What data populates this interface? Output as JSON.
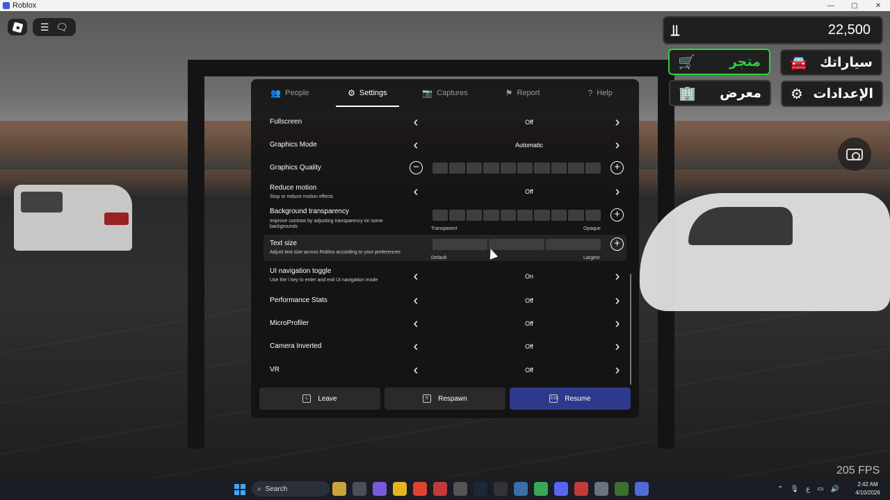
{
  "window": {
    "title": "Roblox",
    "controls": [
      "—",
      "▢",
      "✕"
    ]
  },
  "hud": {
    "currency_symbol": "⃁",
    "money": "22,500",
    "buttons": [
      {
        "id": "store",
        "label": "متجر",
        "icon": "cart-icon",
        "accent": "#2bd33a"
      },
      {
        "id": "my-cars",
        "label": "سياراتك",
        "icon": "car-icon"
      },
      {
        "id": "showroom",
        "label": "معرض",
        "icon": "showroom-icon"
      },
      {
        "id": "settings",
        "label": "الإعدادات",
        "icon": "gear-icon"
      }
    ],
    "fps": "205 FPS"
  },
  "tabs": [
    {
      "label": "People",
      "icon": "people-icon",
      "active": false
    },
    {
      "label": "Settings",
      "icon": "gear-icon",
      "active": true
    },
    {
      "label": "Captures",
      "icon": "camera-icon",
      "active": false
    },
    {
      "label": "Report",
      "icon": "flag-icon",
      "active": false
    },
    {
      "label": "Help",
      "icon": "help-icon",
      "active": false
    }
  ],
  "settings": [
    {
      "label": "Fullscreen",
      "type": "select",
      "value": "Off"
    },
    {
      "label": "Graphics Mode",
      "type": "select",
      "value": "Automatic"
    },
    {
      "label": "Graphics Quality",
      "type": "slider",
      "segments": 10
    },
    {
      "label": "Reduce motion",
      "description": "Stop or reduce motion effects",
      "type": "select",
      "value": "Off"
    },
    {
      "label": "Background transparency",
      "description": "Improve contrast by adjusting transparency on some backgrounds",
      "type": "slider",
      "segments": 10,
      "min_label": "Transparent",
      "max_label": "Opaque"
    },
    {
      "label": "Text size",
      "description": "Adjust text size across Roblox according to your preferences",
      "type": "slider",
      "segments": 3,
      "min_label": "Default",
      "max_label": "Largest"
    },
    {
      "label": "UI navigation toggle",
      "description": "Use the \\ key to enter and exit UI navigation mode",
      "type": "select",
      "value": "On"
    },
    {
      "label": "Performance Stats",
      "type": "select",
      "value": "Off"
    },
    {
      "label": "MicroProfiler",
      "type": "select",
      "value": "Off"
    },
    {
      "label": "Camera Inverted",
      "type": "select",
      "value": "Off"
    },
    {
      "label": "VR",
      "type": "select",
      "value": "Off"
    }
  ],
  "actions": [
    {
      "label": "Leave",
      "key": "L"
    },
    {
      "label": "Respawn",
      "key": "R"
    },
    {
      "label": "Resume",
      "key": "ESC",
      "primary": true
    }
  ],
  "taskbar": {
    "search_placeholder": "Search",
    "time": "2:42 AM",
    "date": "4/10/2026"
  }
}
